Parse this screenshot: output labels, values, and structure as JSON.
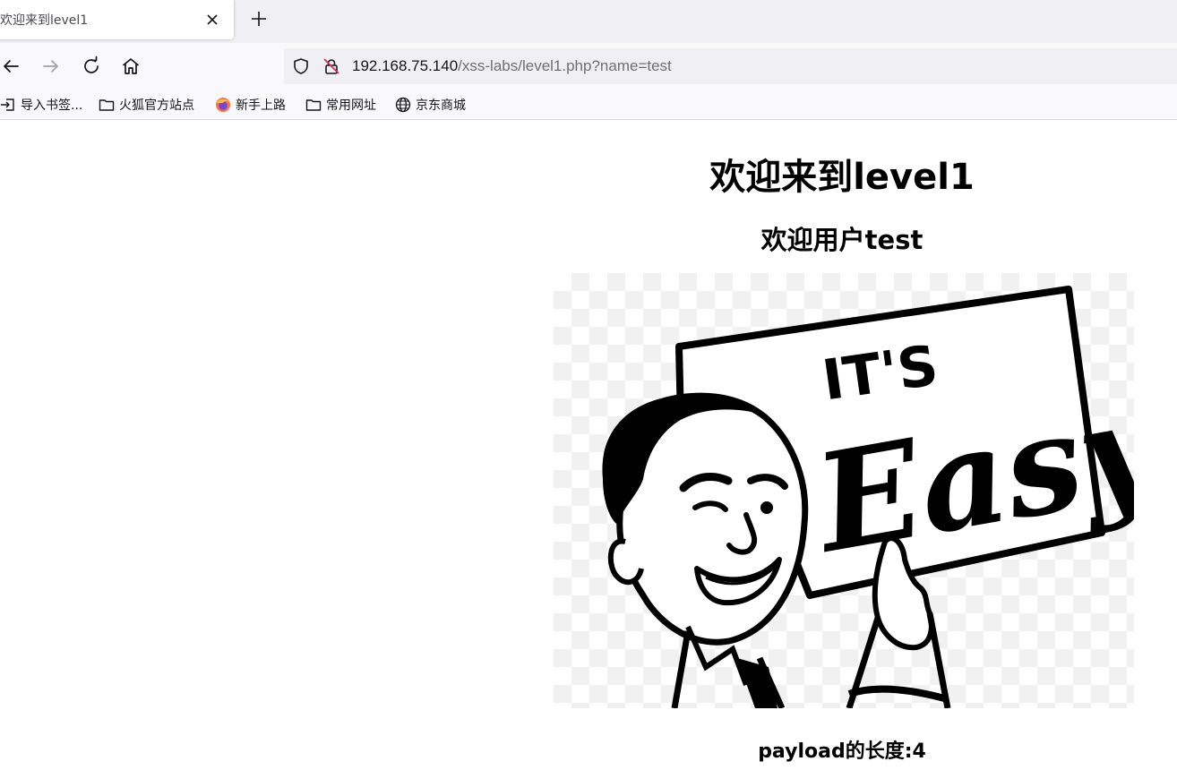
{
  "browser": {
    "tab": {
      "title": "欢迎来到level1"
    },
    "url": {
      "host": "192.168.75.140",
      "path": "/xss-labs/level1.php?name=test"
    },
    "bookmarks": [
      {
        "label": "导入书签...",
        "icon": "import-icon"
      },
      {
        "label": "火狐官方站点",
        "icon": "folder-icon"
      },
      {
        "label": "新手上路",
        "icon": "firefox-icon"
      },
      {
        "label": "常用网址",
        "icon": "folder-icon"
      },
      {
        "label": "京东商城",
        "icon": "globe-icon"
      }
    ]
  },
  "page": {
    "heading": "欢迎来到level1",
    "welcome": "欢迎用户test",
    "image": {
      "sign_line1": "IT'S",
      "sign_line2": "Easy"
    },
    "payload_length": "payload的长度:4"
  }
}
